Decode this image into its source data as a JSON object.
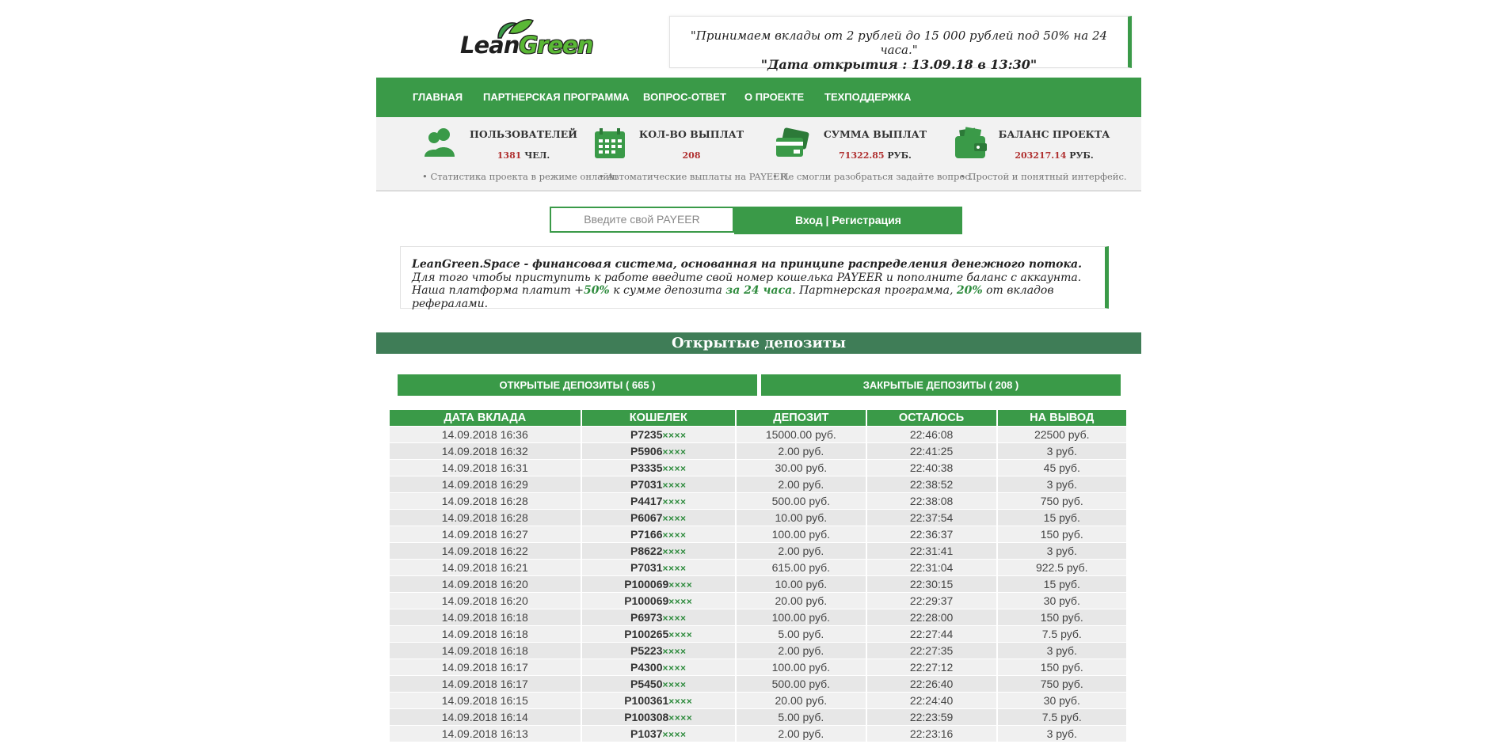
{
  "brand": {
    "logo_part1": "Lean",
    "logo_part2": "Green"
  },
  "header": {
    "quote_line1": "\"Принимаем вклады от 2 рублей до 15 000 рублей под 50% на 24 часа.\"",
    "quote_line2": "\"Дата открытия : 13.09.18 в 13:30\""
  },
  "nav": [
    "ГЛАВНАЯ",
    "ПАРТНЕРСКАЯ ПРОГРАММА",
    "ВОПРОС-ОТВЕТ",
    "О ПРОЕКТЕ",
    "ТЕХПОДДЕРЖКА"
  ],
  "stats": [
    {
      "title": "ПОЛЬЗОВАТЕЛЕЙ",
      "value": "1381",
      "unit": "ЧЕЛ.",
      "note": "• Статистика проекта в режиме онлайн.",
      "icon": "users-icon"
    },
    {
      "title": "КОЛ-ВО ВЫПЛАТ",
      "value": "208",
      "unit": "",
      "note": "• Автоматические выплаты на PAYEER.",
      "icon": "calendar-icon"
    },
    {
      "title": "СУММА ВЫПЛАТ",
      "value": "71322.85",
      "unit": "РУБ.",
      "note": "• Не смогли разобраться задайте вопрос.",
      "icon": "cards-icon"
    },
    {
      "title": "БАЛАНС ПРОЕКТА",
      "value": "203217.14",
      "unit": "РУБ.",
      "note": "• Простой и понятный интерфейс.",
      "icon": "wallet-icon"
    }
  ],
  "login": {
    "placeholder": "Введите свой PAYEER",
    "button": "Вход | Регистрация"
  },
  "info": {
    "line1_bold": "LeanGreen.Space - финансовая система, основанная на принципе распределения денежного потока.",
    "line2": "Для того чтобы приступить к работе введите свой номер кошелька PAYEER и пополните баланс с аккаунта.",
    "line3_a": "Наша платформа платит +",
    "line3_pct": "50%",
    "line3_b": " к сумме депозита ",
    "line3_time": "за 24 часа",
    "line3_c": ".  Партнерская программа, ",
    "line3_ref": "20%",
    "line3_d": " от вкладов рефералами."
  },
  "section_title": "Открытые депозиты",
  "tabs": {
    "open": "ОТКРЫТЫЕ ДЕПОЗИТЫ  ( 665 )",
    "closed": "ЗАКРЫТЫЕ ДЕПОЗИТЫ  ( 208 )"
  },
  "table": {
    "headers": [
      "ДАТА ВКЛАДА",
      "КОШЕЛЕК",
      "ДЕПОЗИТ",
      "ОСТАЛОСЬ",
      "НА ВЫВОД"
    ],
    "mask": "××××",
    "rows": [
      [
        "14.09.2018 16:36",
        "P7235",
        "15000.00 руб.",
        "22:46:08",
        "22500 руб."
      ],
      [
        "14.09.2018 16:32",
        "P5906",
        "2.00 руб.",
        "22:41:25",
        "3 руб."
      ],
      [
        "14.09.2018 16:31",
        "P3335",
        "30.00 руб.",
        "22:40:38",
        "45 руб."
      ],
      [
        "14.09.2018 16:29",
        "P7031",
        "2.00 руб.",
        "22:38:52",
        "3 руб."
      ],
      [
        "14.09.2018 16:28",
        "P4417",
        "500.00 руб.",
        "22:38:08",
        "750 руб."
      ],
      [
        "14.09.2018 16:28",
        "P6067",
        "10.00 руб.",
        "22:37:54",
        "15 руб."
      ],
      [
        "14.09.2018 16:27",
        "P7166",
        "100.00 руб.",
        "22:36:37",
        "150 руб."
      ],
      [
        "14.09.2018 16:22",
        "P8622",
        "2.00 руб.",
        "22:31:41",
        "3 руб."
      ],
      [
        "14.09.2018 16:21",
        "P7031",
        "615.00 руб.",
        "22:31:04",
        "922.5 руб."
      ],
      [
        "14.09.2018 16:20",
        "P100069",
        "10.00 руб.",
        "22:30:15",
        "15 руб."
      ],
      [
        "14.09.2018 16:20",
        "P100069",
        "20.00 руб.",
        "22:29:37",
        "30 руб."
      ],
      [
        "14.09.2018 16:18",
        "P6973",
        "100.00 руб.",
        "22:28:00",
        "150 руб."
      ],
      [
        "14.09.2018 16:18",
        "P100265",
        "5.00 руб.",
        "22:27:44",
        "7.5 руб."
      ],
      [
        "14.09.2018 16:18",
        "P5223",
        "2.00 руб.",
        "22:27:35",
        "3 руб."
      ],
      [
        "14.09.2018 16:17",
        "P4300",
        "100.00 руб.",
        "22:27:12",
        "150 руб."
      ],
      [
        "14.09.2018 16:17",
        "P5450",
        "500.00 руб.",
        "22:26:40",
        "750 руб."
      ],
      [
        "14.09.2018 16:15",
        "P100361",
        "20.00 руб.",
        "22:24:40",
        "30 руб."
      ],
      [
        "14.09.2018 16:14",
        "P100308",
        "5.00 руб.",
        "22:23:59",
        "7.5 руб."
      ],
      [
        "14.09.2018 16:13",
        "P1037",
        "2.00 руб.",
        "22:23:16",
        "3 руб."
      ]
    ]
  },
  "colors": {
    "brand_green": "#3a9a48",
    "section_green": "#3f7d57",
    "value_red": "#b03030"
  }
}
